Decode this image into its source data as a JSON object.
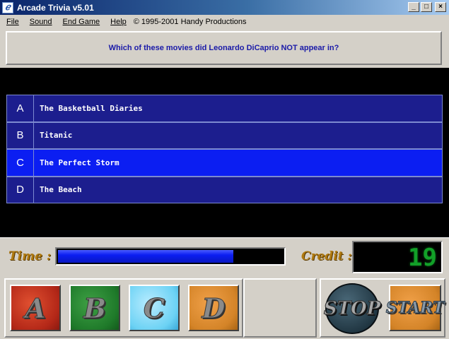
{
  "window": {
    "title": "Arcade Trivia v5.01",
    "icon": "arcade-trivia-icon",
    "controls": {
      "minimize": "_",
      "maximize": "□",
      "close": "×"
    }
  },
  "menu": {
    "items": [
      {
        "label": "File"
      },
      {
        "label": "Sound"
      },
      {
        "label": "End Game"
      },
      {
        "label": "Help"
      }
    ],
    "copyright": "© 1995-2001 Handy Productions"
  },
  "question": "Which of these movies did Leonardo DiCaprio NOT appear in?",
  "answers": [
    {
      "letter": "A",
      "text": "The Basketball Diaries",
      "selected": false
    },
    {
      "letter": "B",
      "text": "Titanic",
      "selected": false
    },
    {
      "letter": "C",
      "text": "The Perfect Storm",
      "selected": true
    },
    {
      "letter": "D",
      "text": "The Beach",
      "selected": false
    }
  ],
  "status": {
    "time_label": "Time :",
    "time_remaining_fraction": 0.78,
    "credit_label": "Credit :",
    "credit_value": "19"
  },
  "buttons": {
    "a": "A",
    "b": "B",
    "c": "C",
    "d": "D",
    "stop": "STOP",
    "start": "START"
  },
  "colors": {
    "answer_bg": "#1c1e8e",
    "answer_selected_bg": "#0b1ef2",
    "question_text": "#1a1aa8",
    "credit_digits": "#12a028",
    "label_gold": "#b07a10"
  }
}
